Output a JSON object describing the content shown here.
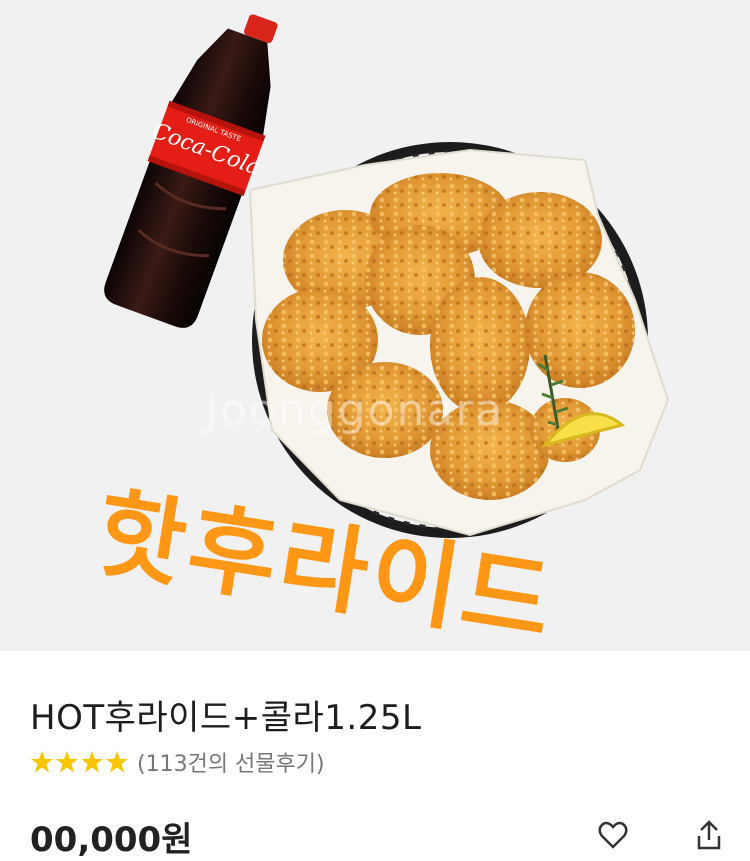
{
  "hero": {
    "promo_text": "핫후라이드",
    "watermark": "Joonggonara",
    "bottle_brand": "Coca-Cola",
    "bottle_subtext": "ORIGINAL TASTE"
  },
  "product": {
    "title": "HOT후라이드+콜라1.25L",
    "stars": 4,
    "review_count_text": "(113건의 선물후기)",
    "price_partial": "00,000원",
    "star_color": "#f7c600",
    "promo_color": "#ff9716"
  },
  "actions": {
    "like_icon": "heart-icon",
    "share_icon": "share-icon"
  }
}
